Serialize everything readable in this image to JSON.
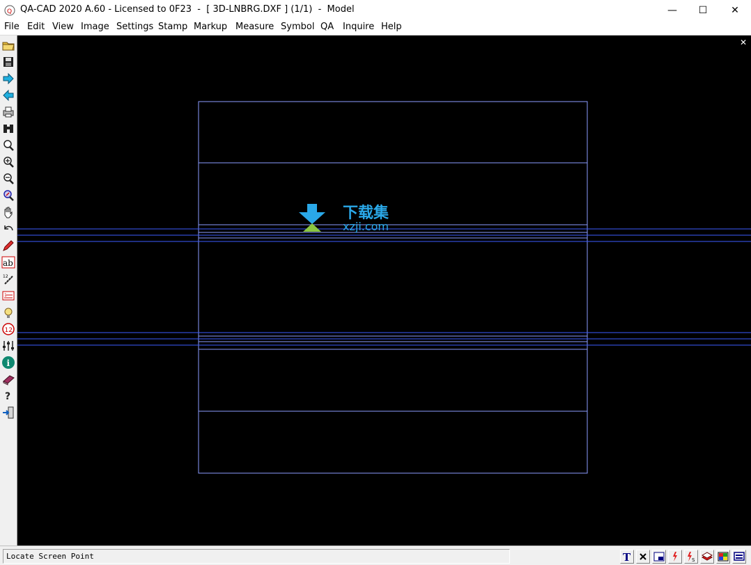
{
  "window": {
    "title": "QA-CAD 2020 A.60 - Licensed to 0F23  -  [ 3D-LNBRG.DXF ] (1/1)  -  Model",
    "minimize_glyph": "—",
    "maximize_glyph": "☐",
    "close_glyph": "✕"
  },
  "menu": {
    "items": [
      "File",
      "Edit",
      "View",
      "Image",
      "Settings",
      "Stamp",
      "Markup",
      "Measure",
      "Symbol",
      "QA",
      "Inquire",
      "Help"
    ]
  },
  "toolbar": {
    "icons": [
      "open-folder-icon",
      "save-icon",
      "forward-arrow-icon",
      "back-arrow-icon",
      "print-icon",
      "binoculars-icon",
      "zoom-icon",
      "zoom-in-icon",
      "zoom-out-icon",
      "zoom-extents-icon",
      "pan-hand-icon",
      "undo-icon",
      "pencil-icon",
      "text-ab-icon",
      "ruler-measure-icon",
      "list-icon",
      "bulb-icon",
      "stamp-12-icon",
      "sliders-icon",
      "info-icon",
      "book-icon",
      "help-icon",
      "exit-icon"
    ]
  },
  "canvas": {
    "close_glyph": "✕",
    "background": "#000000",
    "line_color": "#3b5bff",
    "frame_color": "#8c9cff",
    "watermark_cn": "下载集",
    "watermark_url": "xzji.com"
  },
  "statusbar": {
    "text": "Locate Screen Point",
    "buttons": [
      "text-T-icon",
      "delete-x-icon",
      "window-icon",
      "lightning-icon",
      "lightning-s-icon",
      "layers-icon",
      "color-palette-icon",
      "display-icon"
    ],
    "T_label": "T",
    "x_label": "✕"
  }
}
